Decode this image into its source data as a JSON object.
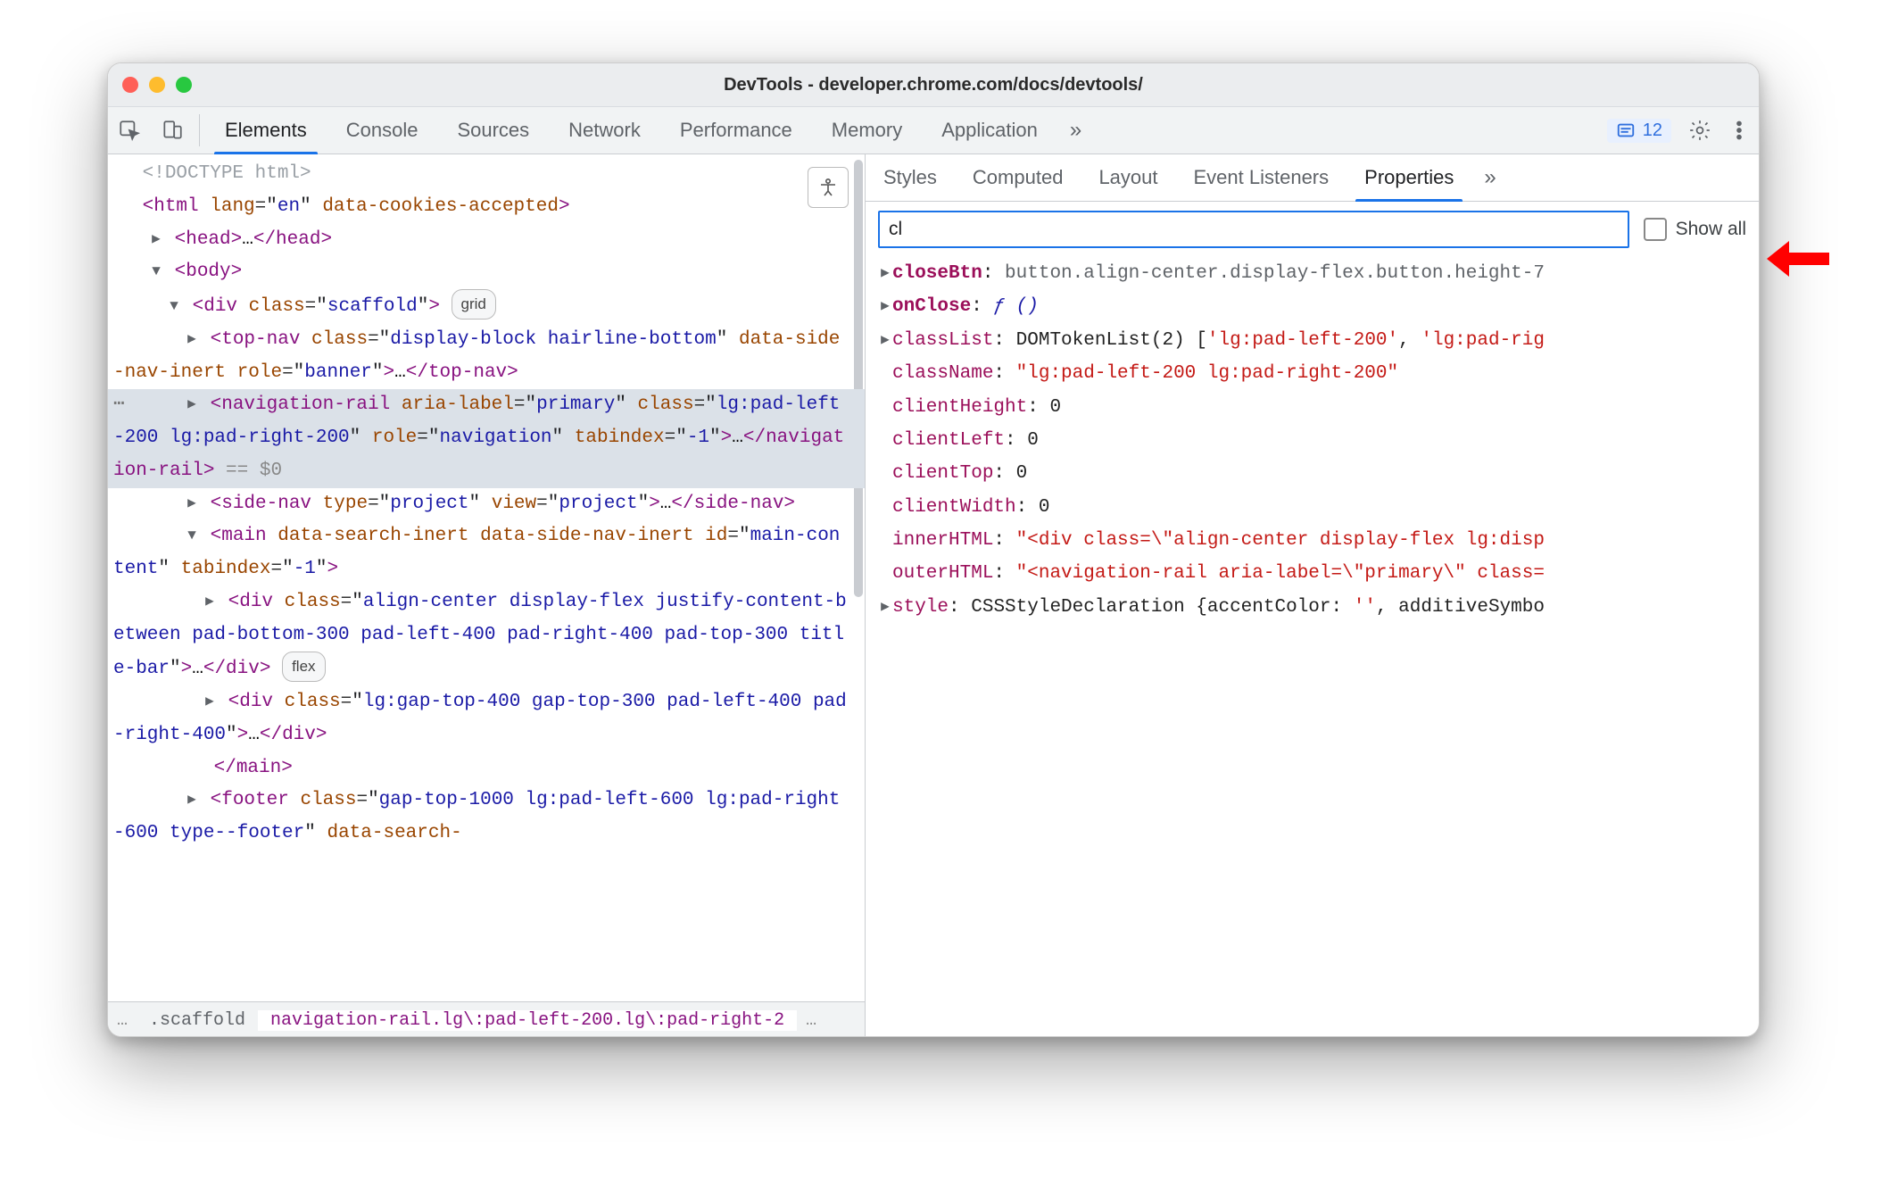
{
  "window": {
    "title": "DevTools - developer.chrome.com/docs/devtools/"
  },
  "mainToolbar": {
    "tabs": [
      "Elements",
      "Console",
      "Sources",
      "Network",
      "Performance",
      "Memory",
      "Application"
    ],
    "activeTab": "Elements",
    "issuesCount": "12"
  },
  "a11yButtonTooltip": "Accessibility",
  "domTree": {
    "doctype": "<!DOCTYPE html>",
    "html": {
      "open": "<html lang=\"en\" data-cookies-accepted>",
      "close": ""
    },
    "head": {
      "text": "<head>…</head>"
    },
    "body": {
      "open": "<body>"
    },
    "scaffold": {
      "text": "<div class=\"scaffold\"> ",
      "badge": "grid"
    },
    "topnav": {
      "text": "<top-nav class=\"display-block hairline-bottom\" data-side-nav-inert role=\"banner\">…</top-nav>"
    },
    "navrail": {
      "text": "<navigation-rail aria-label=\"primary\" class=\"lg:pad-left-200 lg:pad-right-200\" role=\"navigation\" tabindex=\"-1\">…</navigation-rail> == $0"
    },
    "sidenav": {
      "text": "<side-nav type=\"project\" view=\"project\">…</side-nav>"
    },
    "mainOpen": {
      "text": "<main data-search-inert data-side-nav-inert id=\"main-content\" tabindex=\"-1\">"
    },
    "div1": {
      "text": "<div class=\"align-center display-flex justify-content-between pad-bottom-300 pad-left-400 pad-right-400 pad-top-300 title-bar\">…</div> ",
      "badge": "flex"
    },
    "div2": {
      "text": "<div class=\"lg:gap-top-400 gap-top-300 pad-left-400 pad-right-400\">…</div>"
    },
    "mainClose": {
      "text": "</main>"
    },
    "footer": {
      "text": "<footer class=\"gap-top-1000 lg:pad-left-600 lg:pad-right-600 type--footer\" data-search-"
    }
  },
  "breadcrumb": {
    "hiddenLeft": "…",
    "crumbs": [
      ".scaffold",
      "navigation-rail.lg\\:pad-left-200.lg\\:pad-right-2"
    ],
    "activeIndex": 1,
    "hiddenRight": "…"
  },
  "sideTabs": {
    "tabs": [
      "Styles",
      "Computed",
      "Layout",
      "Event Listeners",
      "Properties"
    ],
    "activeTab": "Properties"
  },
  "filter": {
    "value": "cl",
    "showAllLabel": "Show all",
    "showAllChecked": false
  },
  "properties": [
    {
      "expandable": true,
      "bold": true,
      "key": "closeBtn",
      "valueHtml": "button.align-center.display-flex.button.height-7",
      "valueClass": "dk"
    },
    {
      "expandable": true,
      "bold": true,
      "key": "onClose",
      "valueHtml": "ƒ ()",
      "valueClass": "func"
    },
    {
      "expandable": true,
      "bold": false,
      "key": "classList",
      "valueHtml": "DOMTokenList(2) ['lg:pad-left-200', 'lg:pad-rig",
      "valueClass": "mixed1"
    },
    {
      "expandable": false,
      "bold": false,
      "key": "className",
      "valueHtml": "\"lg:pad-left-200 lg:pad-right-200\"",
      "valueClass": "ps"
    },
    {
      "expandable": false,
      "bold": false,
      "key": "clientHeight",
      "valueHtml": "0",
      "valueClass": "pv"
    },
    {
      "expandable": false,
      "bold": false,
      "key": "clientLeft",
      "valueHtml": "0",
      "valueClass": "pv"
    },
    {
      "expandable": false,
      "bold": false,
      "key": "clientTop",
      "valueHtml": "0",
      "valueClass": "pv"
    },
    {
      "expandable": false,
      "bold": false,
      "key": "clientWidth",
      "valueHtml": "0",
      "valueClass": "pv"
    },
    {
      "expandable": false,
      "bold": false,
      "key": "innerHTML",
      "valueHtml": "\"<div class=\\\"align-center display-flex lg:disp",
      "valueClass": "ps"
    },
    {
      "expandable": false,
      "bold": false,
      "key": "outerHTML",
      "valueHtml": "\"<navigation-rail aria-label=\\\"primary\\\" class=",
      "valueClass": "ps"
    },
    {
      "expandable": true,
      "bold": false,
      "key": "style",
      "valueHtml": "CSSStyleDeclaration {accentColor: '', additiveSymbo",
      "valueClass": "mixed2"
    }
  ]
}
